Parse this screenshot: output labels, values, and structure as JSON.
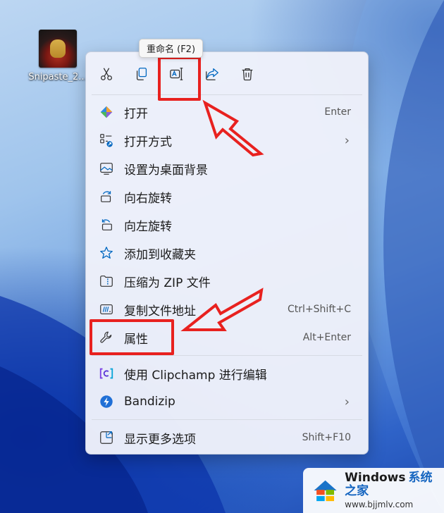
{
  "desktop": {
    "icon_label": "Snipaste_2..."
  },
  "tooltip": "重命名 (F2)",
  "toolbar": [
    {
      "name": "cut-button",
      "icon": "scissors-icon"
    },
    {
      "name": "copy-button",
      "icon": "copy-icon"
    },
    {
      "name": "rename-button",
      "icon": "rename-icon"
    },
    {
      "name": "share-button",
      "icon": "share-icon"
    },
    {
      "name": "delete-button",
      "icon": "trash-icon"
    }
  ],
  "menu": {
    "open": {
      "label": "打开",
      "shortcut": "Enter",
      "icon": "app-icon"
    },
    "open_with": {
      "label": "打开方式",
      "chevron": "›",
      "icon": "open-with-icon"
    },
    "set_wallpaper": {
      "label": "设置为桌面背景",
      "icon": "wallpaper-icon"
    },
    "rotate_right": {
      "label": "向右旋转",
      "icon": "rotate-right-icon"
    },
    "rotate_left": {
      "label": "向左旋转",
      "icon": "rotate-left-icon"
    },
    "add_favorite": {
      "label": "添加到收藏夹",
      "icon": "star-icon"
    },
    "compress_zip": {
      "label": "压缩为 ZIP 文件",
      "icon": "zip-icon"
    },
    "copy_path": {
      "label": "复制文件地址",
      "shortcut": "Ctrl+Shift+C",
      "icon": "path-icon"
    },
    "properties": {
      "label": "属性",
      "shortcut": "Alt+Enter",
      "icon": "wrench-icon"
    },
    "clipchamp": {
      "label": "使用 Clipchamp 进行编辑",
      "icon": "clipchamp-icon"
    },
    "bandizip": {
      "label": "Bandizip",
      "chevron": "›",
      "icon": "bandizip-icon"
    },
    "more_options": {
      "label": "显示更多选项",
      "shortcut": "Shift+F10",
      "icon": "more-options-icon"
    }
  },
  "watermark": {
    "title": "Windows",
    "title_cn": "系统之家",
    "url": "www.bjjmlv.com"
  },
  "colors": {
    "highlight": "#e8211f",
    "accent": "#0067c0"
  }
}
